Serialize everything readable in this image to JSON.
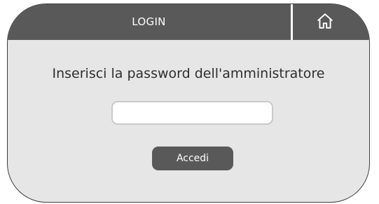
{
  "header": {
    "title": "LOGIN",
    "home_icon": "home-icon"
  },
  "main": {
    "prompt": "Inserisci la password dell'amministratore",
    "password_value": "",
    "login_label": "Accedi"
  },
  "colors": {
    "header_bg": "#595959",
    "panel_bg": "#e6e6e6",
    "button_bg": "#595959"
  }
}
